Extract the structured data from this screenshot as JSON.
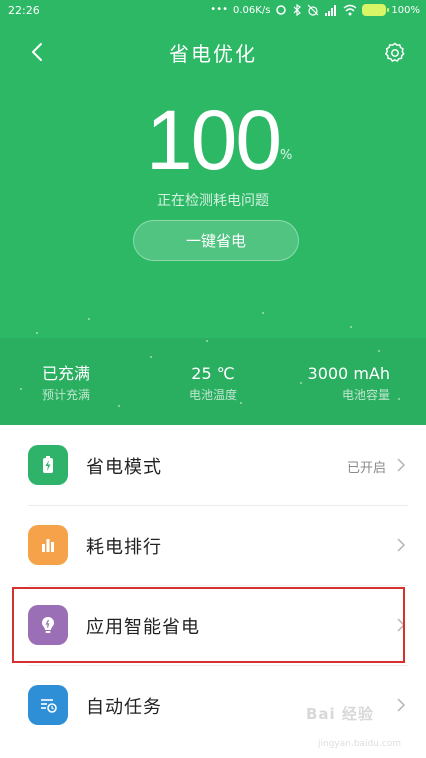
{
  "status_bar": {
    "time": "22:26",
    "network_speed": "0.06K/s",
    "battery_percent": "100%"
  },
  "header": {
    "title": "省电优化",
    "battery_level": "100",
    "percent_sign": "%",
    "status_text": "正在检测耗电问题",
    "save_button_label": "一键省电",
    "color": "#2db866"
  },
  "stats": [
    {
      "value": "已充满",
      "label": "预计充满"
    },
    {
      "value": "25 ℃",
      "label": "电池温度"
    },
    {
      "value": "3000 mAh",
      "label": "电池容量"
    }
  ],
  "menu": [
    {
      "label": "省电模式",
      "value": "已开启",
      "icon": "battery-bolt-icon",
      "color": "#2fb36b"
    },
    {
      "label": "耗电排行",
      "value": "",
      "icon": "bar-chart-icon",
      "color": "#f6a24a"
    },
    {
      "label": "应用智能省电",
      "value": "",
      "icon": "lightbulb-icon",
      "color": "#9a6fb5"
    },
    {
      "label": "自动任务",
      "value": "",
      "icon": "task-clock-icon",
      "color": "#2e8fd6"
    }
  ],
  "watermark": {
    "text": "Bai 经验",
    "sub": "jingyan.baidu.com"
  }
}
